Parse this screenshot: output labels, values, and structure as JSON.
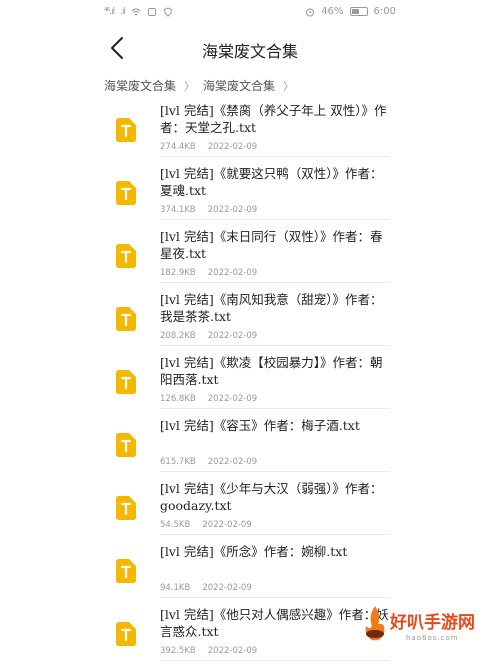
{
  "status_bar": {
    "signal_left": "⁴⁶.ıl",
    "signal_left2": ".ıl",
    "battery_percent": "46%",
    "time": "6:00",
    "icons": [
      "wifi-icon",
      "notification-icon",
      "alarm-icon",
      "battery-icon"
    ]
  },
  "nav": {
    "title": "海棠废文合集",
    "back_icon": "chevron-left-icon"
  },
  "breadcrumb": {
    "items": [
      "海棠废文合集",
      "海棠废文合集"
    ]
  },
  "files": [
    {
      "name": "[lvl 完结]《禁脔（养父子年上 双性）》作者：天堂之孔.txt",
      "size": "274.4KB",
      "date": "2022-02-09"
    },
    {
      "name": "[lvl 完结]《就要这只鸭（双性）》作者：夏魂.txt",
      "size": "374.1KB",
      "date": "2022-02-09"
    },
    {
      "name": "[lvl 完结]《末日同行（双性）》作者：春星夜.txt",
      "size": "182.9KB",
      "date": "2022-02-09"
    },
    {
      "name": "[lvl 完结]《南风知我意（甜宠）》作者：我是茶茶.txt",
      "size": "208.2KB",
      "date": "2022-02-09"
    },
    {
      "name": "[lvl 完结]《欺凌【校园暴力】》作者：朝阳西落.txt",
      "size": "126.8KB",
      "date": "2022-02-09"
    },
    {
      "name": "[lvl 完结]《容玉》作者：梅子酒.txt",
      "size": "615.7KB",
      "date": "2022-02-09"
    },
    {
      "name": "[lvl 完结]《少年与大汉（弱强）》作者：goodazy.txt",
      "size": "54.5KB",
      "date": "2022-02-09"
    },
    {
      "name": "[lvl 完结]《所念》作者：婉柳.txt",
      "size": "94.1KB",
      "date": "2022-02-09"
    },
    {
      "name": "[lvl 完结]《他只对人偶感兴趣》作者：妖言惑众.txt",
      "size": "392.5KB",
      "date": "2022-02-09"
    }
  ],
  "file_icon_color": "#f5b800",
  "watermark": {
    "text": "好叭手游网",
    "sub": "hao8os.com"
  }
}
